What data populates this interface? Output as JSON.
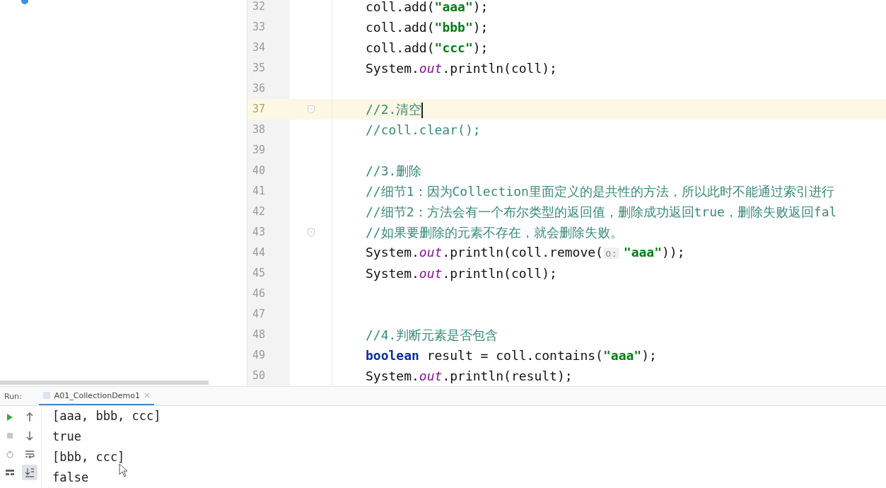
{
  "editor": {
    "lines": [
      {
        "number": "32",
        "current": false,
        "fold": false,
        "tokens": [
          {
            "kind": "plain",
            "text": "coll.add("
          },
          {
            "kind": "string",
            "text": "\"aaa\""
          },
          {
            "kind": "plain",
            "text": ");"
          }
        ]
      },
      {
        "number": "33",
        "current": false,
        "fold": false,
        "tokens": [
          {
            "kind": "plain",
            "text": "coll.add("
          },
          {
            "kind": "string",
            "text": "\"bbb\""
          },
          {
            "kind": "plain",
            "text": ");"
          }
        ]
      },
      {
        "number": "34",
        "current": false,
        "fold": false,
        "tokens": [
          {
            "kind": "plain",
            "text": "coll.add("
          },
          {
            "kind": "string",
            "text": "\"ccc\""
          },
          {
            "kind": "plain",
            "text": ");"
          }
        ]
      },
      {
        "number": "35",
        "current": false,
        "fold": false,
        "tokens": [
          {
            "kind": "plain",
            "text": "System."
          },
          {
            "kind": "field",
            "text": "out"
          },
          {
            "kind": "plain",
            "text": ".println(coll);"
          }
        ]
      },
      {
        "number": "36",
        "current": false,
        "fold": false
      },
      {
        "number": "37",
        "current": true,
        "fold": true,
        "tokens": [
          {
            "kind": "comment",
            "text": "//2.清空"
          }
        ]
      },
      {
        "number": "38",
        "current": false,
        "fold": false,
        "tokens": [
          {
            "kind": "comment",
            "text": "//coll.clear();"
          }
        ]
      },
      {
        "number": "39",
        "current": false,
        "fold": false
      },
      {
        "number": "40",
        "current": false,
        "fold": false,
        "tokens": [
          {
            "kind": "comment",
            "text": "//3.删除"
          }
        ]
      },
      {
        "number": "41",
        "current": false,
        "fold": false,
        "tokens": [
          {
            "kind": "comment",
            "text": "//细节1：因为Collection里面定义的是共性的方法，所以此时不能通过索引进行"
          }
        ]
      },
      {
        "number": "42",
        "current": false,
        "fold": false,
        "tokens": [
          {
            "kind": "comment",
            "text": "//细节2：方法会有一个布尔类型的返回值，删除成功返回true，删除失败返回fal"
          }
        ]
      },
      {
        "number": "43",
        "current": false,
        "fold": true,
        "tokens": [
          {
            "kind": "comment",
            "text": "//如果要删除的元素不存在，就会删除失败。"
          }
        ]
      },
      {
        "number": "44",
        "current": false,
        "fold": false,
        "tokens": [
          {
            "kind": "plain",
            "text": "System."
          },
          {
            "kind": "field",
            "text": "out"
          },
          {
            "kind": "plain",
            "text": ".println(coll.remove("
          },
          {
            "kind": "hint",
            "text": "o:"
          },
          {
            "kind": "string",
            "text": "\"aaa\""
          },
          {
            "kind": "plain",
            "text": "));"
          }
        ]
      },
      {
        "number": "45",
        "current": false,
        "fold": false,
        "tokens": [
          {
            "kind": "plain",
            "text": "System."
          },
          {
            "kind": "field",
            "text": "out"
          },
          {
            "kind": "plain",
            "text": ".println(coll);"
          }
        ]
      },
      {
        "number": "46",
        "current": false,
        "fold": false
      },
      {
        "number": "47",
        "current": false,
        "fold": false
      },
      {
        "number": "48",
        "current": false,
        "fold": false,
        "tokens": [
          {
            "kind": "comment",
            "text": "//4.判断元素是否包含"
          }
        ]
      },
      {
        "number": "49",
        "current": false,
        "fold": false,
        "tokens": [
          {
            "kind": "keyword",
            "text": "boolean"
          },
          {
            "kind": "plain",
            "text": " result = coll.contains("
          },
          {
            "kind": "string",
            "text": "\"aaa\""
          },
          {
            "kind": "plain",
            "text": ");"
          }
        ]
      },
      {
        "number": "50",
        "current": false,
        "fold": false,
        "tokens": [
          {
            "kind": "plain",
            "text": "System."
          },
          {
            "kind": "field",
            "text": "out"
          },
          {
            "kind": "plain",
            "text": ".println(result);"
          }
        ]
      }
    ]
  },
  "run_panel": {
    "label": "Run:",
    "tab": "A01_CollectionDemo1",
    "tools": [
      {
        "kind": "rerun",
        "selected": false
      },
      {
        "kind": "up",
        "selected": false
      },
      {
        "kind": "stop",
        "selected": false
      },
      {
        "kind": "down",
        "selected": false
      },
      {
        "kind": "restore",
        "selected": false
      },
      {
        "kind": "wrap",
        "selected": false
      },
      {
        "kind": "layout",
        "selected": false
      },
      {
        "kind": "scroll-end",
        "selected": true
      }
    ],
    "output": [
      "[aaa, bbb, ccc]",
      "true",
      "[bbb, ccc]",
      "false"
    ]
  }
}
